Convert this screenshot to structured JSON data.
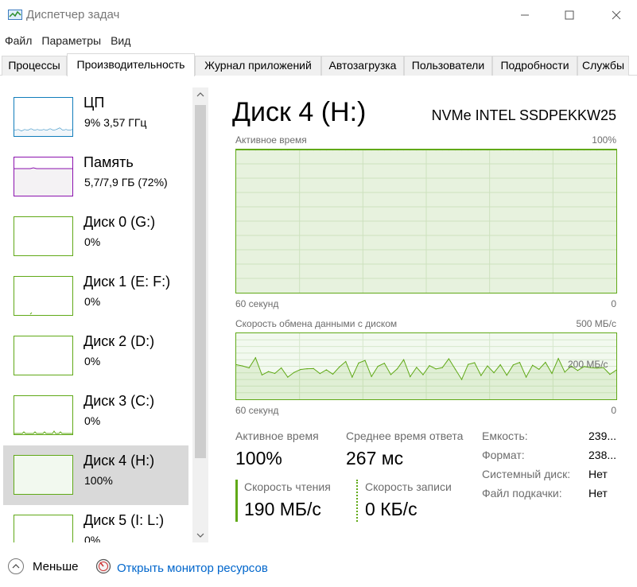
{
  "window": {
    "title": "Диспетчер задач",
    "minimize_icon": "minimize-icon",
    "maximize_icon": "maximize-icon",
    "close_icon": "close-icon"
  },
  "menu": [
    "Файл",
    "Параметры",
    "Вид"
  ],
  "tabs": [
    "Процессы",
    "Производительность",
    "Журнал приложений",
    "Автозагрузка",
    "Пользователи",
    "Подробности",
    "Службы"
  ],
  "active_tab": 1,
  "sidebar": {
    "items": [
      {
        "name": "ЦП",
        "value": "9%  3,57 ГГц",
        "kind": "cpu"
      },
      {
        "name": "Память",
        "value": "5,7/7,9 ГБ (72%)",
        "kind": "memory"
      },
      {
        "name": "Диск 0 (G:)",
        "value": "0%",
        "kind": "disk"
      },
      {
        "name": "Диск 1 (E: F:)",
        "value": "0%",
        "kind": "disk"
      },
      {
        "name": "Диск 2 (D:)",
        "value": "0%",
        "kind": "disk"
      },
      {
        "name": "Диск 3 (C:)",
        "value": "0%",
        "kind": "disk"
      },
      {
        "name": "Диск 4 (H:)",
        "value": "100%",
        "kind": "disk",
        "selected": true
      },
      {
        "name": "Диск 5 (I: L:)",
        "value": "0%",
        "kind": "disk"
      }
    ]
  },
  "detail": {
    "title": "Диск 4 (H:)",
    "model": "NVMe INTEL SSDPEKKW25",
    "active_chart": {
      "label": "Активное время",
      "max_label": "100%",
      "time_label": "60 секунд",
      "min_label": "0"
    },
    "transfer_chart": {
      "label": "Скорость обмена данными с диском",
      "max_label": "500 МБ/с",
      "mid_label": "200 МБ/с",
      "time_label": "60 секунд",
      "min_label": "0"
    },
    "stats": {
      "active_time_label": "Активное время",
      "active_time_value": "100%",
      "response_label": "Среднее время ответа",
      "response_value": "267 мс",
      "read_label": "Скорость чтения",
      "read_value": "190 МБ/с",
      "write_label": "Скорость записи",
      "write_value": "0 КБ/с"
    },
    "info": [
      {
        "label": "Емкость:",
        "value": "239..."
      },
      {
        "label": "Формат:",
        "value": "238..."
      },
      {
        "label": "Системный диск:",
        "value": "Нет"
      },
      {
        "label": "Файл подкачки:",
        "value": "Нет"
      }
    ]
  },
  "footer": {
    "less_label": "Меньше",
    "monitor_label": "Открыть монитор ресурсов"
  },
  "colors": {
    "disk_accent": "#60a917",
    "disk_fill": "#f2f9ef",
    "cpu_accent": "#117dbb",
    "memory_accent": "#8b12ae",
    "link": "#0066cc",
    "selected_bg": "#d9d9d9"
  },
  "chart_data": [
    {
      "type": "area",
      "title": "Активное время",
      "xlabel": "60 секунд",
      "ylim": [
        0,
        100
      ],
      "x_range": [
        60,
        0
      ],
      "values": [
        100,
        100,
        100,
        100,
        100,
        100,
        100,
        100,
        100,
        100,
        100,
        100,
        100,
        100,
        100,
        100,
        100,
        100,
        100,
        100,
        100,
        100,
        100,
        100,
        100,
        100,
        100,
        100,
        100,
        100,
        100,
        100,
        100,
        100,
        100,
        100,
        100,
        100,
        100,
        100,
        100,
        100,
        100,
        100,
        100,
        100,
        100,
        100,
        100,
        100,
        100,
        100,
        100,
        100,
        100,
        100,
        100,
        100,
        100,
        100
      ]
    },
    {
      "type": "line",
      "title": "Скорость обмена данными с диском",
      "xlabel": "60 секунд",
      "ylabel": "МБ/с",
      "ylim": [
        0,
        500
      ],
      "x_range": [
        60,
        0
      ],
      "values": [
        262,
        252,
        238,
        315,
        184,
        210,
        196,
        238,
        168,
        204,
        226,
        231,
        233,
        195,
        223,
        190,
        244,
        286,
        168,
        275,
        294,
        172,
        250,
        273,
        187,
        231,
        300,
        171,
        242,
        186,
        255,
        230,
        240,
        307,
        228,
        150,
        264,
        277,
        180,
        253,
        201,
        262,
        182,
        260,
        279,
        168,
        258,
        227,
        280,
        196,
        309,
        206,
        252,
        218,
        248,
        240,
        236,
        240,
        189,
        221
      ]
    }
  ]
}
